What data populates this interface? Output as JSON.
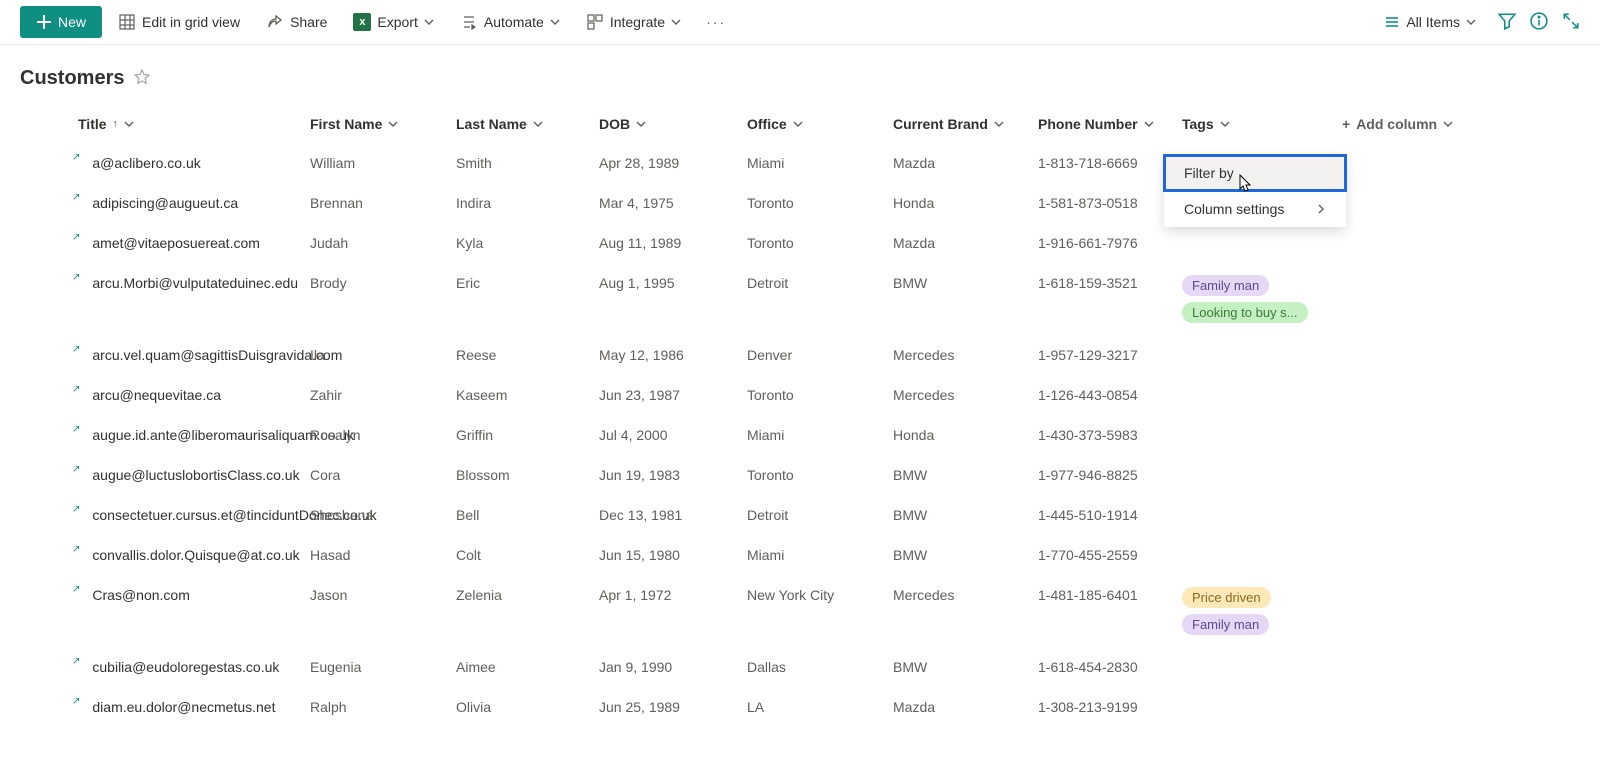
{
  "toolbar": {
    "new_label": "New",
    "edit_grid_label": "Edit in grid view",
    "share_label": "Share",
    "export_label": "Export",
    "automate_label": "Automate",
    "integrate_label": "Integrate",
    "view_label": "All Items"
  },
  "list": {
    "title": "Customers"
  },
  "columns": {
    "title": "Title",
    "first_name": "First Name",
    "last_name": "Last Name",
    "dob": "DOB",
    "office": "Office",
    "brand": "Current Brand",
    "phone": "Phone Number",
    "tags": "Tags",
    "add_column": "Add column"
  },
  "menu": {
    "filter_by": "Filter by",
    "column_settings": "Column settings"
  },
  "tag_colors": {
    "Family man": "tag-purple",
    "Looking to buy s...": "tag-green",
    "Price driven": "tag-yellow"
  },
  "rows": [
    {
      "title": "a@aclibero.co.uk",
      "fn": "William",
      "ln": "Smith",
      "dob": "Apr 28, 1989",
      "off": "Miami",
      "brand": "Mazda",
      "phone": "1-813-718-6669",
      "tags": []
    },
    {
      "title": "adipiscing@augueut.ca",
      "fn": "Brennan",
      "ln": "Indira",
      "dob": "Mar 4, 1975",
      "off": "Toronto",
      "brand": "Honda",
      "phone": "1-581-873-0518",
      "tags": []
    },
    {
      "title": "amet@vitaeposuereat.com",
      "fn": "Judah",
      "ln": "Kyla",
      "dob": "Aug 11, 1989",
      "off": "Toronto",
      "brand": "Mazda",
      "phone": "1-916-661-7976",
      "tags": []
    },
    {
      "title": "arcu.Morbi@vulputateduinec.edu",
      "fn": "Brody",
      "ln": "Eric",
      "dob": "Aug 1, 1995",
      "off": "Detroit",
      "brand": "BMW",
      "phone": "1-618-159-3521",
      "tags": [
        "Family man",
        "Looking to buy s..."
      ]
    },
    {
      "title": "arcu.vel.quam@sagittisDuisgravida.com",
      "fn": "Ila",
      "ln": "Reese",
      "dob": "May 12, 1986",
      "off": "Denver",
      "brand": "Mercedes",
      "phone": "1-957-129-3217",
      "tags": []
    },
    {
      "title": "arcu@nequevitae.ca",
      "fn": "Zahir",
      "ln": "Kaseem",
      "dob": "Jun 23, 1987",
      "off": "Toronto",
      "brand": "Mercedes",
      "phone": "1-126-443-0854",
      "tags": []
    },
    {
      "title": "augue.id.ante@liberomaurisaliquam.co.uk",
      "fn": "Rosalyn",
      "ln": "Griffin",
      "dob": "Jul 4, 2000",
      "off": "Miami",
      "brand": "Honda",
      "phone": "1-430-373-5983",
      "tags": []
    },
    {
      "title": "augue@luctuslobortisClass.co.uk",
      "fn": "Cora",
      "ln": "Blossom",
      "dob": "Jun 19, 1983",
      "off": "Toronto",
      "brand": "BMW",
      "phone": "1-977-946-8825",
      "tags": []
    },
    {
      "title": "consectetuer.cursus.et@tinciduntDonec.co.uk",
      "fn": "Shoshana",
      "ln": "Bell",
      "dob": "Dec 13, 1981",
      "off": "Detroit",
      "brand": "BMW",
      "phone": "1-445-510-1914",
      "tags": []
    },
    {
      "title": "convallis.dolor.Quisque@at.co.uk",
      "fn": "Hasad",
      "ln": "Colt",
      "dob": "Jun 15, 1980",
      "off": "Miami",
      "brand": "BMW",
      "phone": "1-770-455-2559",
      "tags": []
    },
    {
      "title": "Cras@non.com",
      "fn": "Jason",
      "ln": "Zelenia",
      "dob": "Apr 1, 1972",
      "off": "New York City",
      "brand": "Mercedes",
      "phone": "1-481-185-6401",
      "tags": [
        "Price driven",
        "Family man"
      ]
    },
    {
      "title": "cubilia@eudoloregestas.co.uk",
      "fn": "Eugenia",
      "ln": "Aimee",
      "dob": "Jan 9, 1990",
      "off": "Dallas",
      "brand": "BMW",
      "phone": "1-618-454-2830",
      "tags": []
    },
    {
      "title": "diam.eu.dolor@necmetus.net",
      "fn": "Ralph",
      "ln": "Olivia",
      "dob": "Jun 25, 1989",
      "off": "LA",
      "brand": "Mazda",
      "phone": "1-308-213-9199",
      "tags": []
    }
  ]
}
